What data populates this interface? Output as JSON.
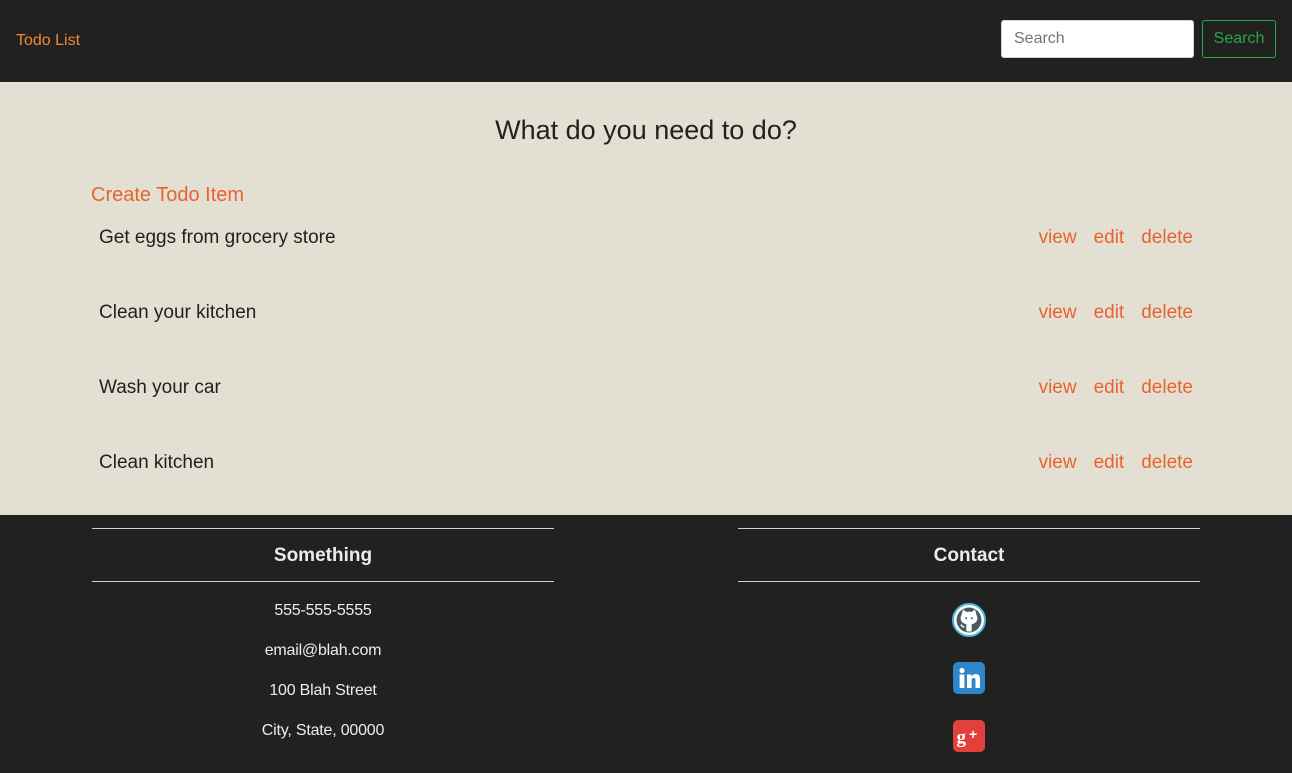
{
  "navbar": {
    "brand": "Todo List",
    "search_placeholder": "Search",
    "search_button": "Search"
  },
  "main": {
    "title": "What do you need to do?",
    "create_link": "Create Todo Item",
    "todos": [
      {
        "text": "Get eggs from grocery store",
        "view": "view",
        "edit": "edit",
        "delete": "delete"
      },
      {
        "text": "Clean your kitchen",
        "view": "view",
        "edit": "edit",
        "delete": "delete"
      },
      {
        "text": "Wash your car",
        "view": "view",
        "edit": "edit",
        "delete": "delete"
      },
      {
        "text": "Clean kitchen",
        "view": "view",
        "edit": "edit",
        "delete": "delete"
      }
    ]
  },
  "footer": {
    "left_heading": "Something",
    "contact_lines": [
      "555-555-5555",
      "email@blah.com",
      "100 Blah Street",
      "City, State, 00000"
    ],
    "right_heading": "Contact",
    "social_icons": [
      "github-icon",
      "linkedin-icon",
      "google-plus-icon"
    ]
  },
  "colors": {
    "brand": "#f0892e",
    "accent": "#e9632f",
    "search_button": "#28a745",
    "main_background": "#e3e0d3",
    "dark_background": "#212121",
    "github": "#4bb7d6",
    "linkedin": "#2e86c9",
    "google_plus": "#e2403a"
  }
}
